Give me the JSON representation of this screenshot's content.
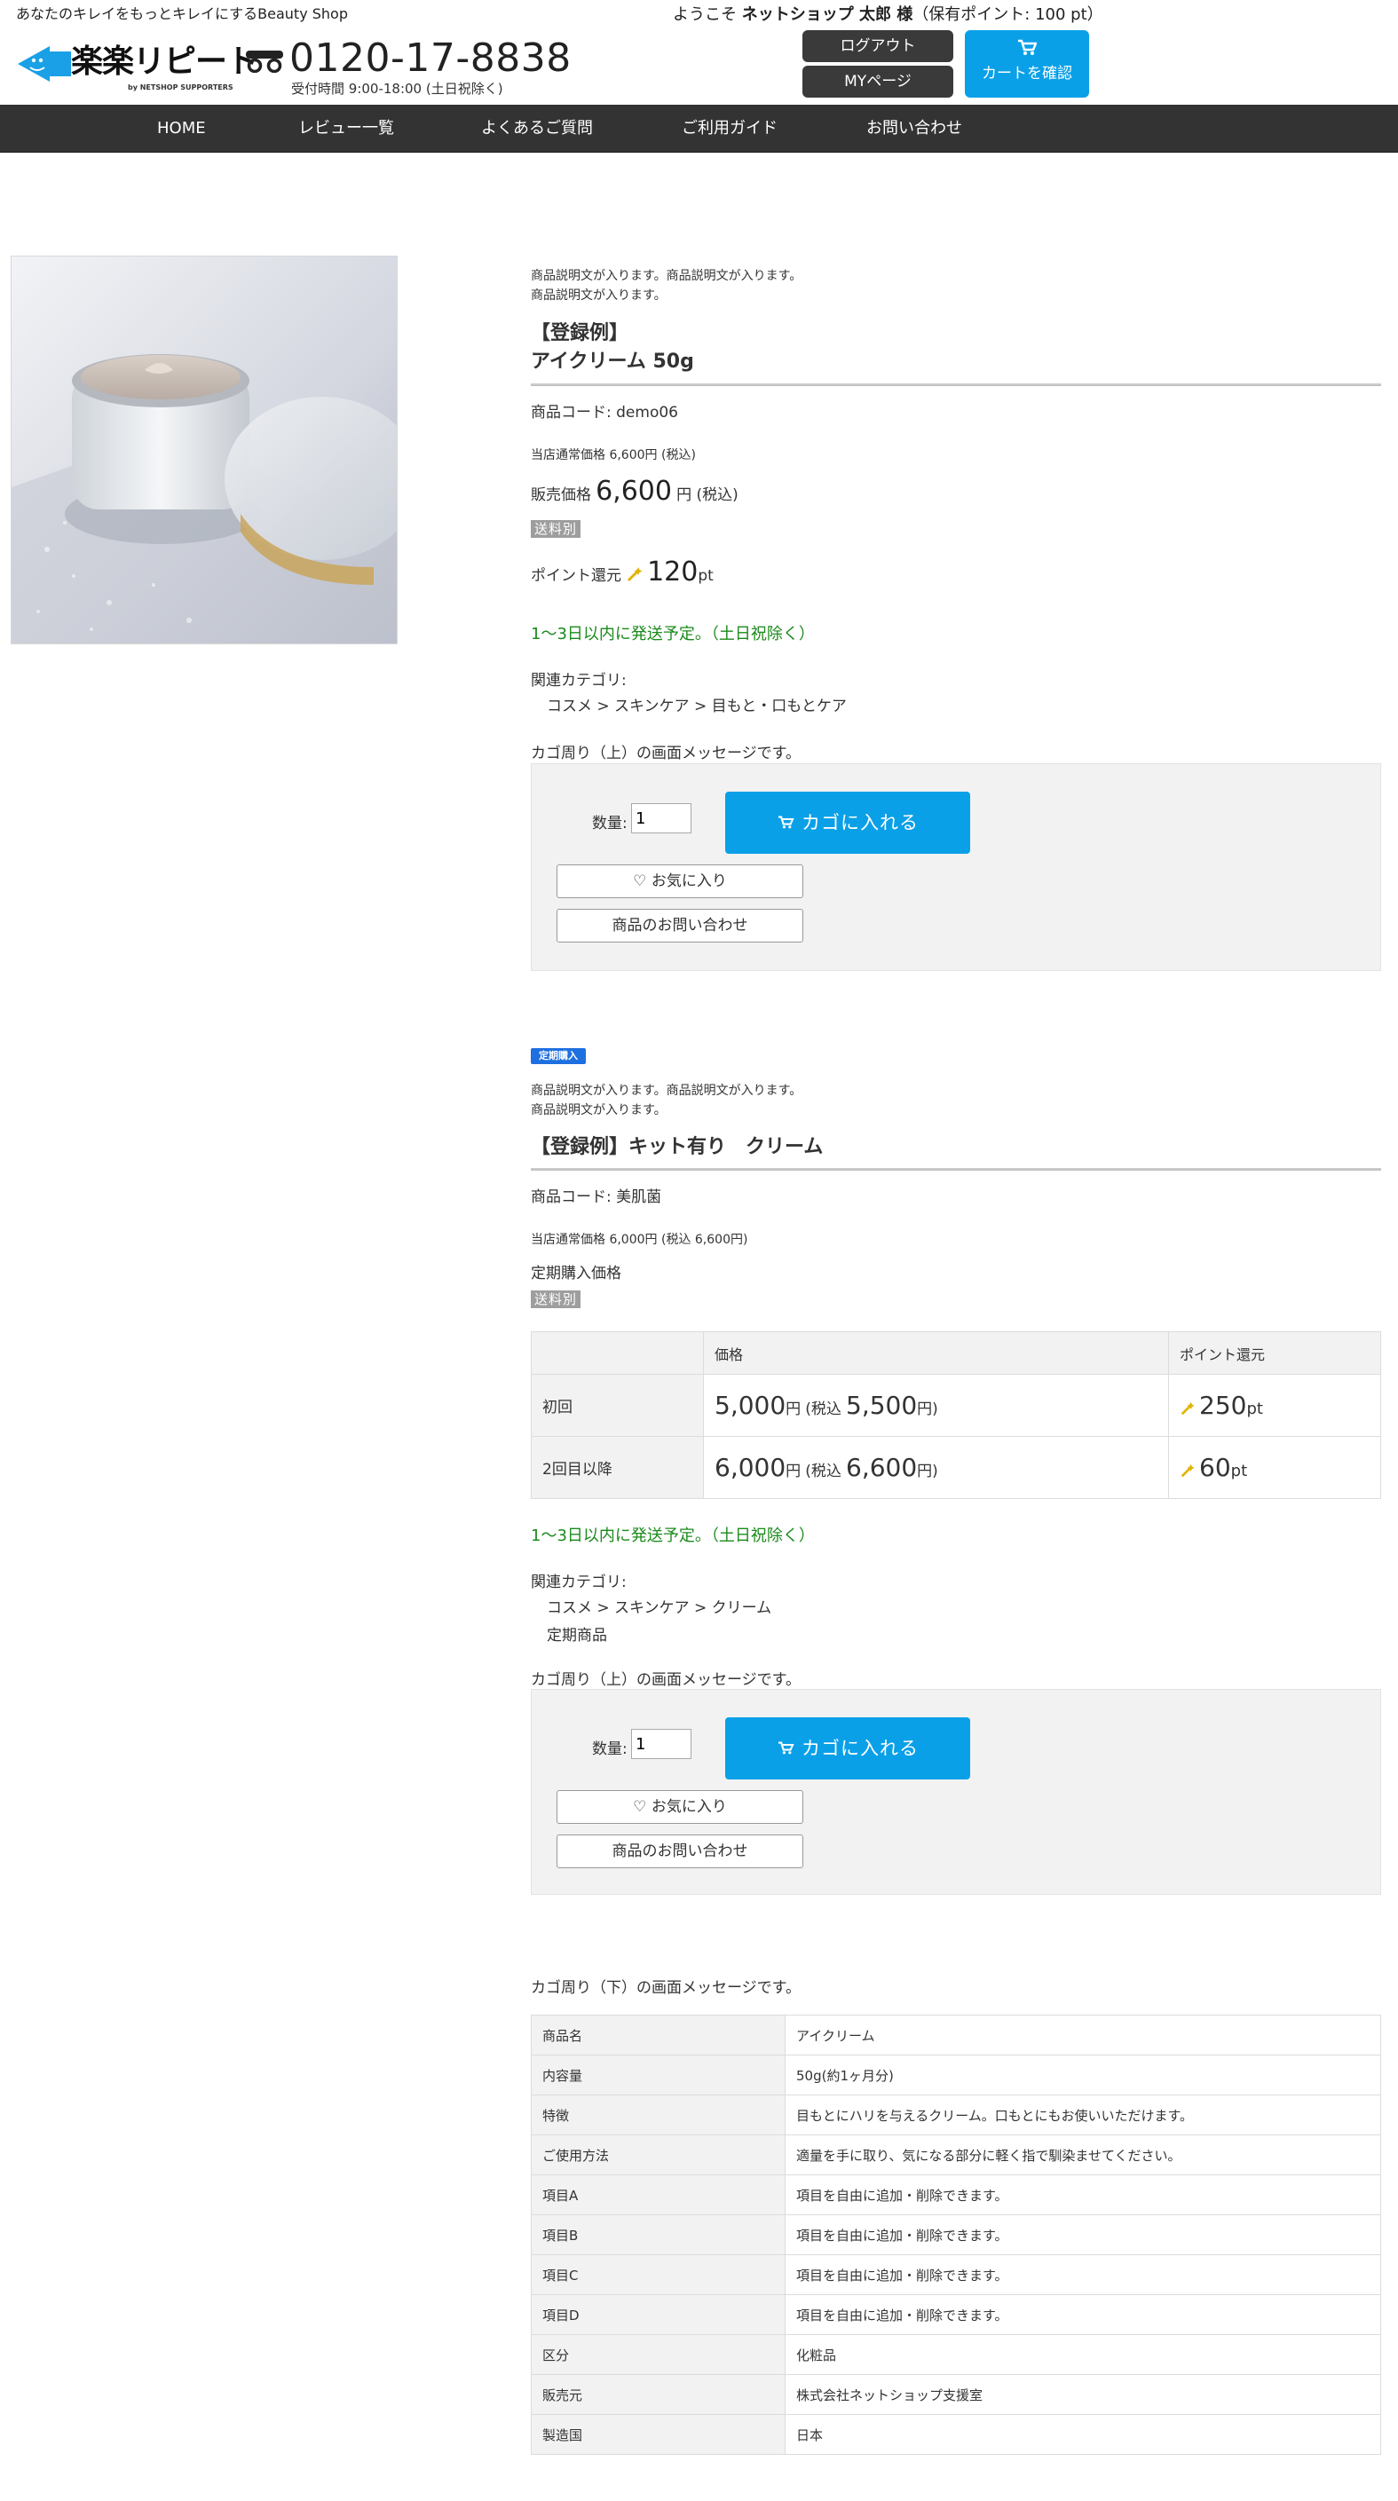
{
  "header": {
    "tagline": "あなたのキレイをもっとキレイにするBeauty Shop",
    "logo_text": "楽楽リピート",
    "logo_sub": "by NETSHOP SUPPORTERS",
    "phone_number": "0120-17-8838",
    "phone_hours": "受付時間 9:00-18:00 (土日祝除く)",
    "welcome_prefix": "ようこそ ",
    "welcome_user": "ネットショップ 太郎 様",
    "welcome_points": "（保有ポイント: 100 pt）",
    "logout_label": "ログアウト",
    "mypage_label": "MYページ",
    "cart_label": "カートを確認"
  },
  "nav": {
    "items": [
      {
        "label": "HOME"
      },
      {
        "label": "レビュー一覧"
      },
      {
        "label": "よくあるご質問"
      },
      {
        "label": "ご利用ガイド"
      },
      {
        "label": "お問い合わせ"
      }
    ]
  },
  "product": {
    "description_1": "商品説明文が入ります。商品説明文が入ります。",
    "description_2": "商品説明文が入ります。",
    "title_line1": "【登録例】",
    "title_line2": "アイクリーム 50g",
    "code": "商品コード: demo06",
    "regular_price": "当店通常価格 6,600円 (税込)",
    "sale_label": "販売価格",
    "sale_price": "6,600",
    "sale_unit": "円 (税込)",
    "shipping_badge": "送料別",
    "point_label": "ポイント還元",
    "point_value": "120",
    "point_unit": "pt",
    "shipping_note": "1〜3日以内に発送予定。（土日祝除く）",
    "category_label": "関連カテゴリ:",
    "category_path": "コスメ > スキンケア > 目もと・口もとケア",
    "cart_message_top": "カゴ周り（上）の画面メッセージです。",
    "qty_label": "数量:",
    "qty_value": "1",
    "add_to_cart": "カゴに入れる",
    "favorite": "お気に入り",
    "inquiry": "商品のお問い合わせ"
  },
  "subscription": {
    "badge": "定期購入",
    "description_1": "商品説明文が入ります。商品説明文が入ります。",
    "description_2": "商品説明文が入ります。",
    "title": "【登録例】キット有り　クリーム",
    "code": "商品コード: 美肌菌",
    "regular_price": "当店通常価格 6,000円 (税込 6,600円)",
    "sub_price_label": "定期購入価格",
    "shipping_badge": "送料別",
    "table_headers": [
      "",
      "価格",
      "ポイント還元"
    ],
    "rows": [
      {
        "label": "初回",
        "price": "5,000",
        "price_unit": "円",
        "tax_label": "(税込",
        "tax_price": "5,500",
        "tax_unit": "円)",
        "points": "250",
        "points_unit": "pt"
      },
      {
        "label": "2回目以降",
        "price": "6,000",
        "price_unit": "円",
        "tax_label": "(税込",
        "tax_price": "6,600",
        "tax_unit": "円)",
        "points": "60",
        "points_unit": "pt"
      }
    ],
    "shipping_note": "1〜3日以内に発送予定。（土日祝除く）",
    "category_label": "関連カテゴリ:",
    "category_path_1": "コスメ > スキンケア > クリーム",
    "category_path_2": "定期商品",
    "cart_message_top": "カゴ周り（上）の画面メッセージです。",
    "qty_label": "数量:",
    "qty_value": "1",
    "add_to_cart": "カゴに入れる",
    "favorite": "お気に入り",
    "inquiry": "商品のお問い合わせ"
  },
  "specs": {
    "cart_message_bottom": "カゴ周り（下）の画面メッセージです。",
    "rows": [
      {
        "key": "商品名",
        "value": "アイクリーム"
      },
      {
        "key": "内容量",
        "value": "50g(約1ヶ月分)"
      },
      {
        "key": "特徴",
        "value": "目もとにハリを与えるクリーム。口もとにもお使いいただけます。"
      },
      {
        "key": "ご使用方法",
        "value": "適量を手に取り、気になる部分に軽く指で馴染ませてください。"
      },
      {
        "key": "項目A",
        "value": "項目を自由に追加・削除できます。"
      },
      {
        "key": "項目B",
        "value": "項目を自由に追加・削除できます。"
      },
      {
        "key": "項目C",
        "value": "項目を自由に追加・削除できます。"
      },
      {
        "key": "項目D",
        "value": "項目を自由に追加・削除できます。"
      },
      {
        "key": "区分",
        "value": "化粧品"
      },
      {
        "key": "販売元",
        "value": "株式会社ネットショップ支援室"
      },
      {
        "key": "製造国",
        "value": "日本"
      }
    ]
  },
  "colors": {
    "accent_blue": "#0aa0e8",
    "nav_bg": "#333333",
    "ship_green": "#1b8a1b",
    "badge_blue": "#1e6fe0",
    "point_icon": "#e0b400"
  },
  "icons": [
    "logo-megaphone-icon",
    "freedial-icon",
    "cart-icon",
    "heart-icon",
    "point-wand-icon"
  ]
}
